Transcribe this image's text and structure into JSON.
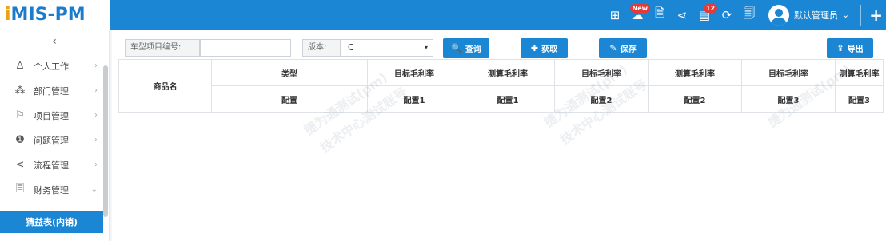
{
  "app": {
    "logo_i": "i",
    "logo_rest": "MIS-PM"
  },
  "topbar": {
    "icons": [
      {
        "name": "grid-icon",
        "glyph": "⊞"
      },
      {
        "name": "chat-icon",
        "glyph": "☁",
        "badge": "New"
      },
      {
        "name": "document-icon",
        "glyph": "🗎"
      },
      {
        "name": "share-icon",
        "glyph": "⋖"
      },
      {
        "name": "calendar-icon",
        "glyph": "▤",
        "badge": "12"
      },
      {
        "name": "refresh-icon",
        "glyph": "⟳"
      },
      {
        "name": "export-doc-icon",
        "glyph": "🗐"
      }
    ],
    "user_name": "默认管理员",
    "user_caret": "⌄",
    "plus": "+"
  },
  "sidebar": {
    "collapse": "‹",
    "items": [
      {
        "label": "个人工作",
        "icon": "♙",
        "arrow": "›"
      },
      {
        "label": "部门管理",
        "icon": "⁂",
        "arrow": "›"
      },
      {
        "label": "项目管理",
        "icon": "⚐",
        "arrow": "›"
      },
      {
        "label": "问题管理",
        "icon": "❶",
        "arrow": "›"
      },
      {
        "label": "流程管理",
        "icon": "⋖",
        "arrow": "›"
      },
      {
        "label": "财务管理",
        "icon": "🗏",
        "arrow": "⌄"
      }
    ],
    "active": "猜益表(内销)"
  },
  "toolbar": {
    "project_label": "车型项目编号:",
    "project_value": "",
    "version_label": "版本:",
    "version_value": "C",
    "select_arrow": "▾",
    "query": "查询",
    "fetch": "获取",
    "save": "保存",
    "export": "导出",
    "query_icon": "🔍",
    "fetch_icon": "✚",
    "save_icon": "✎",
    "export_icon": "⇪"
  },
  "table": {
    "row_header": "商品名",
    "type_label": "类型",
    "config_label": "配置",
    "columns": [
      {
        "metric": "目标毛利率",
        "config": "配置1"
      },
      {
        "metric": "测算毛利率",
        "config": "配置1"
      },
      {
        "metric": "目标毛利率",
        "config": "配置2"
      },
      {
        "metric": "测算毛利率",
        "config": "配置2"
      },
      {
        "metric": "目标毛利率",
        "config": "配置3"
      },
      {
        "metric": "测算毛利率",
        "config": "配置3"
      }
    ]
  },
  "watermark": [
    "捷为通测试(pm)",
    "技术中心测试账号"
  ]
}
